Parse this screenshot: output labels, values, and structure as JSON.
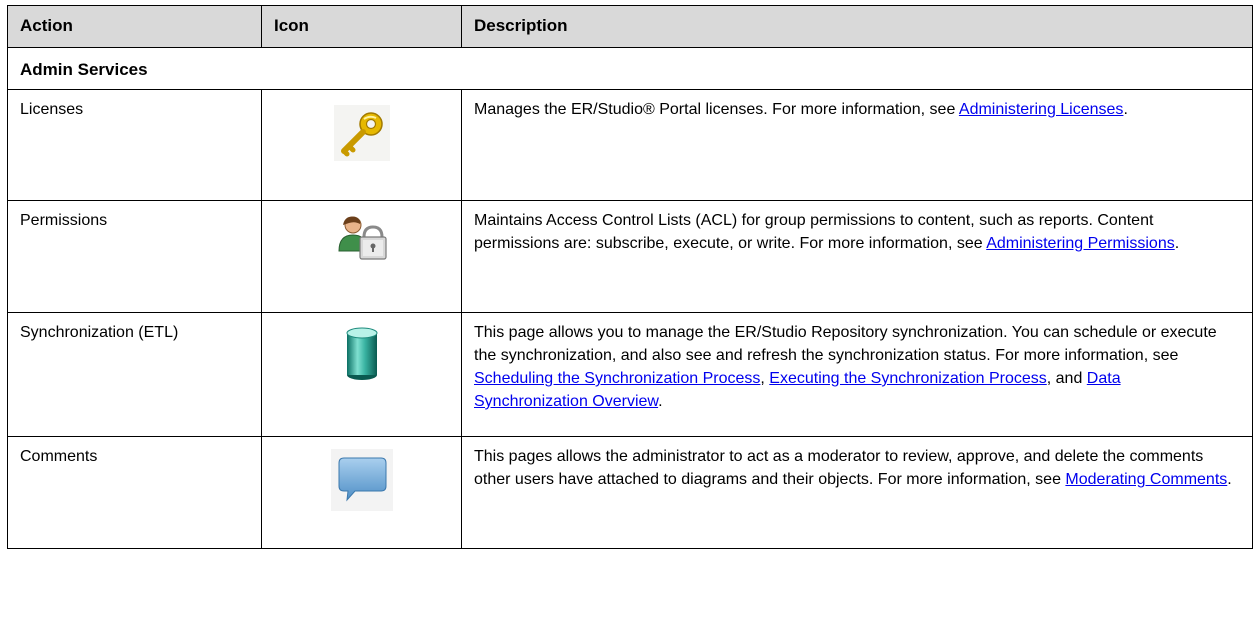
{
  "headers": {
    "action": "Action",
    "icon": "Icon",
    "description": "Description"
  },
  "section": {
    "title": "Admin Services"
  },
  "rows": [
    {
      "action": "Licenses",
      "icon_name": "key-icon",
      "desc_text": "Manages the ER/Studio® Portal licenses. For more information, see ",
      "link1": "Administering Licenses",
      "desc_end": "."
    },
    {
      "action": "Permissions",
      "icon_name": "user-lock-icon",
      "desc_text": "Maintains Access Control Lists (ACL) for group permissions to content, such as reports. Content permissions are: subscribe, execute, or write. For more information, see ",
      "link1": "Administering Permissions",
      "desc_end": "."
    },
    {
      "action": "Synchronization (ETL)",
      "icon_name": "database-icon",
      "desc_text": "This page allows you to manage the ER/Studio Repository synchronization. You can schedule or execute the synchronization, and also see and refresh the synchronization status. For more information, see ",
      "link1": "Scheduling the Synchronization Process",
      "sep1": ", ",
      "link2": "Executing the Synchronization Process",
      "sep2": ", and ",
      "link3": "Data Synchronization Overview",
      "desc_end": "."
    },
    {
      "action": "Comments",
      "icon_name": "speech-bubble-icon",
      "desc_text": "This pages allows the administrator to act as a moderator to review, approve, and delete the comments other users have attached to diagrams and their objects. For more information, see ",
      "link1": "Moderating Comments",
      "desc_end": "."
    }
  ],
  "colors": {
    "header_bg": "#d9d9d9",
    "link": "#0000ee",
    "border": "#000000"
  }
}
